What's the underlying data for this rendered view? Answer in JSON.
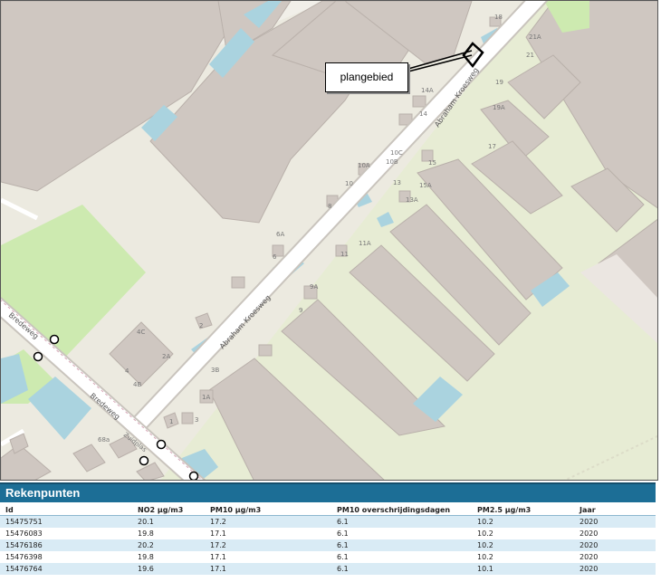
{
  "map": {
    "callout_label": "plangebied",
    "street_labels": [
      "Abraham Kroesweg",
      "Abraham Kroesweg",
      "Bredeweg",
      "Bredeweg",
      "Zuidplas"
    ],
    "house_numbers": [
      "18",
      "21A",
      "21",
      "19",
      "19A",
      "17",
      "14A",
      "14",
      "10C",
      "10B",
      "10A",
      "10",
      "15",
      "15A",
      "13",
      "13A",
      "11A",
      "11",
      "9A",
      "9",
      "8",
      "6A",
      "6",
      "4C",
      "2A",
      "4",
      "4B",
      "2",
      "3B",
      "1A",
      "3",
      "1",
      "68a"
    ],
    "colors": {
      "building": "#cfc7c1",
      "building_edge": "#b9b0aa",
      "terrain": "#f1efe9",
      "yard": "#e7ecd4",
      "grass": "#cdeab0",
      "water": "#aad3df",
      "road": "#ffffff"
    }
  },
  "rekenpunten": {
    "title": "Rekenpunten",
    "columns": [
      "Id",
      "NO2 µg/m3",
      "PM10 µg/m3",
      "PM10 overschrijdingsdagen",
      "PM2.5 µg/m3",
      "Jaar"
    ],
    "rows": [
      [
        "15475751",
        "20.1",
        "17.2",
        "6.1",
        "10.2",
        "2020"
      ],
      [
        "15476083",
        "19.8",
        "17.1",
        "6.1",
        "10.2",
        "2020"
      ],
      [
        "15476186",
        "20.2",
        "17.2",
        "6.1",
        "10.2",
        "2020"
      ],
      [
        "15476398",
        "19.8",
        "17.1",
        "6.1",
        "10.2",
        "2020"
      ],
      [
        "15476764",
        "19.6",
        "17.1",
        "6.1",
        "10.1",
        "2020"
      ]
    ]
  }
}
